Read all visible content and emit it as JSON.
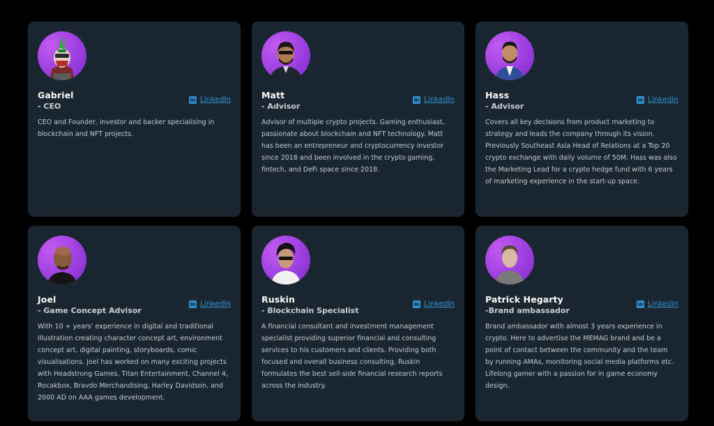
{
  "team": {
    "linkedin_label": "LinkedIn",
    "members": [
      {
        "name": "Gabriel",
        "role": "- CEO",
        "bio": "CEO and Founder, investor and backer specialising in blockchain and NFT projects."
      },
      {
        "name": "Matt",
        "role": "- Advisor",
        "bio": "Advisor of multiple crypto projects. Gaming enthusiast, passionate about blockchain and NFT technology. Matt has been an entrepreneur and cryptocurrency investor since 2018 and been involved in the crypto gaming, fintech, and DeFi space since 2018."
      },
      {
        "name": "Hass",
        "role": "- Advisor",
        "bio": "Covers all key decisions from product marketing to strategy and leads the company through its vision. Previously Southeast Asia Head of Relations at a Top 20 crypto exchange with daily volume of 50M. Hass was also the Marketing Lead for a crypto hedge fund with 6 years of marketing experience in the start-up space."
      },
      {
        "name": "Joel",
        "role": "- Game Concept Advisor",
        "bio": "With 10 + years' experience in digital and traditional illustration creating character concept art, environment concept art, digital painting, storyboards, comic visualisations. Joel has worked on many exciting projects with Headstrong Games, Titan Entertainment, Channel 4, Rocakbox, Bravdo Merchandising, Harley Davidson, and 2000 AD on AAA games development."
      },
      {
        "name": "Ruskin",
        "role": "- Blockchain Specialist",
        "bio": "A financial consultant and investment management specialist providing superior financial and consulting services to his customers and clients. Providing both focused and overall business consulting, Ruskin formulates the best sell-side financial research reports across the industry."
      },
      {
        "name": "Patrick Hegarty",
        "role": "-Brand ambassador",
        "bio": "Brand ambassador with almost 3 years experience in crypto. Here to advertise the MEMAG brand and be a point of contact between the community and the team by running AMAs, monitoring social media platforms etc. Lifelong gamer with a passion for in game economy design."
      }
    ]
  },
  "colors": {
    "page_bg": "#000000",
    "card_bg": "#1b2730",
    "avatar_purple": "#9d3fe0",
    "link_blue": "#2b93d4"
  },
  "icons": {
    "linkedin": "linkedin-icon"
  }
}
